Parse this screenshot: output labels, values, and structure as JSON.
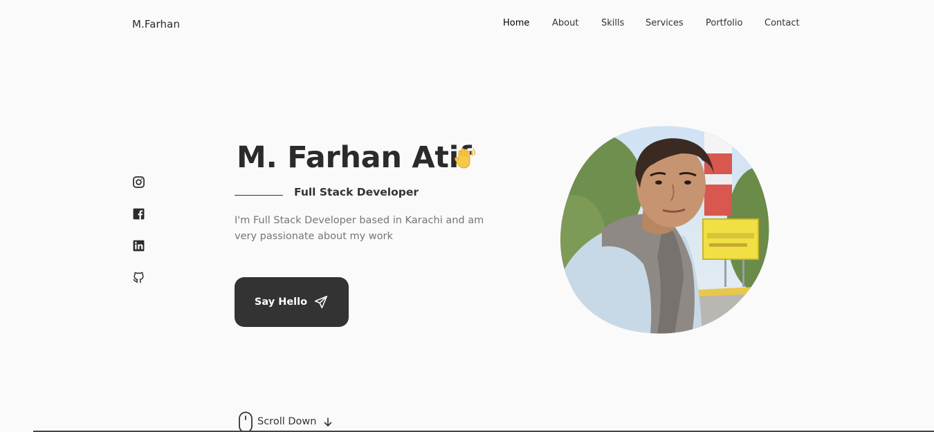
{
  "header": {
    "logo": "M.Farhan",
    "nav": [
      {
        "label": "Home",
        "active": true
      },
      {
        "label": "About",
        "active": false
      },
      {
        "label": "Skills",
        "active": false
      },
      {
        "label": "Services",
        "active": false
      },
      {
        "label": "Portfolio",
        "active": false
      },
      {
        "label": "Contact",
        "active": false
      }
    ]
  },
  "social": [
    {
      "icon": "instagram-icon"
    },
    {
      "icon": "facebook-icon"
    },
    {
      "icon": "linkedin-icon"
    },
    {
      "icon": "github-icon"
    }
  ],
  "hero": {
    "name": "M. Farhan Atif",
    "wave_icon": "waving-hand-icon",
    "subtitle": "Full Stack Developer",
    "description": "I'm Full Stack Developer based in Karachi and am very passionate about my work",
    "cta_label": "Say Hello",
    "cta_icon": "send-icon"
  },
  "profile": {
    "image": "profile-photo"
  },
  "scroll": {
    "label": "Scroll Down",
    "icon": "mouse-icon",
    "arrow_icon": "arrow-down-icon"
  },
  "colors": {
    "background": "#fafafa",
    "text": "#333333",
    "muted": "#757575",
    "button": "#333333",
    "button_text": "#ffffff"
  }
}
